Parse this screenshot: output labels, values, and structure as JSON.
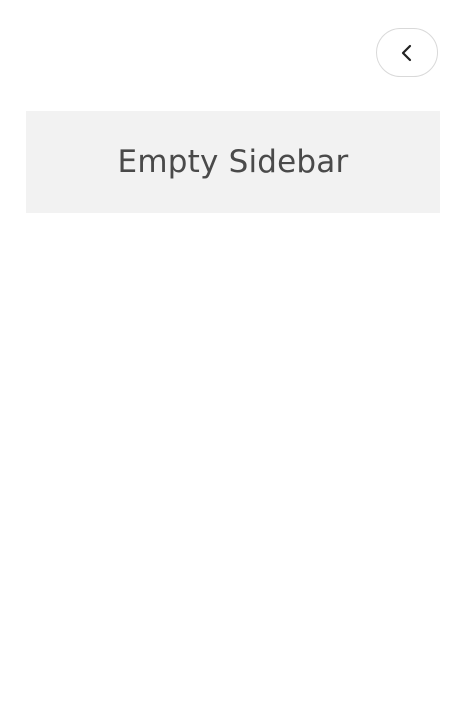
{
  "sidebar": {
    "collapse_button": {
      "icon": "chevron-left-icon"
    },
    "empty_state": {
      "label": "Empty Sidebar"
    }
  },
  "colors": {
    "background": "#ffffff",
    "panel_background": "#f2f2f2",
    "text": "#4a4a4a",
    "button_border": "#d9d9d9",
    "icon": "#222222"
  }
}
